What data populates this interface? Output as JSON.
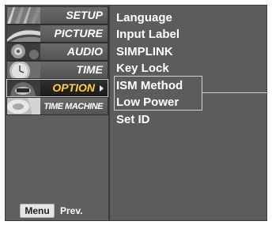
{
  "sidebar": {
    "items": [
      {
        "label": "SETUP",
        "icon": "setup-thumbnail-icon"
      },
      {
        "label": "PICTURE",
        "icon": "picture-thumbnail-icon"
      },
      {
        "label": "AUDIO",
        "icon": "audio-thumbnail-icon"
      },
      {
        "label": "TIME",
        "icon": "time-thumbnail-icon"
      },
      {
        "label": "OPTION",
        "icon": "option-thumbnail-icon",
        "selected": true
      },
      {
        "label": "TIME MACHINE",
        "icon": "time-machine-thumbnail-icon"
      }
    ],
    "footer": {
      "menu_button": "Menu",
      "prev_label": "Prev."
    }
  },
  "option_menu": {
    "items": [
      "Language",
      "Input Label",
      "SIMPLINK",
      "Key Lock",
      "ISM Method",
      "Low Power",
      "Set ID"
    ]
  },
  "colors": {
    "selected_text": "#ffd23a",
    "panel_background": "#5c5c5c"
  }
}
